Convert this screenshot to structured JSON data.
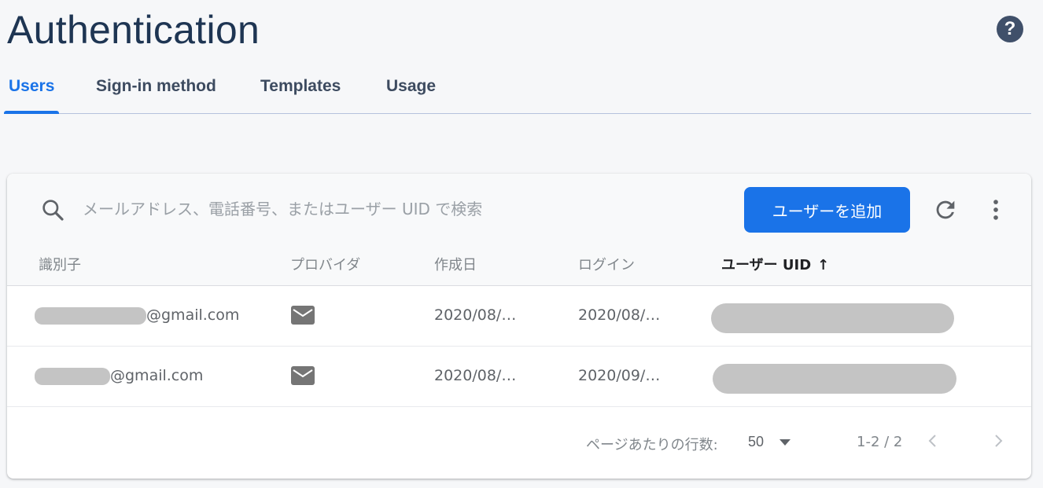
{
  "page": {
    "title": "Authentication"
  },
  "tabs": [
    {
      "label": "Users",
      "active": true
    },
    {
      "label": "Sign-in method",
      "active": false
    },
    {
      "label": "Templates",
      "active": false
    },
    {
      "label": "Usage",
      "active": false
    }
  ],
  "toolbar": {
    "search_placeholder": "メールアドレス、電話番号、またはユーザー UID で検索",
    "add_user_label": "ユーザーを追加"
  },
  "columns": {
    "identifier": "識別子",
    "provider": "プロバイダ",
    "created": "作成日",
    "login": "ログイン",
    "uid": "ユーザー UID",
    "uid_sort_arrow": "↑"
  },
  "rows": [
    {
      "email_suffix": "@gmail.com",
      "provider_icon": "mail-icon",
      "created": "2020/08/…",
      "login": "2020/08/…"
    },
    {
      "email_suffix": "@gmail.com",
      "provider_icon": "mail-icon",
      "created": "2020/08/…",
      "login": "2020/09/…"
    }
  ],
  "pagination": {
    "rows_per_page_label": "ページあたりの行数:",
    "rows_per_page_value": "50",
    "range": "1-2 / 2"
  },
  "colors": {
    "accent": "#1a73e8",
    "title": "#1e3553"
  }
}
